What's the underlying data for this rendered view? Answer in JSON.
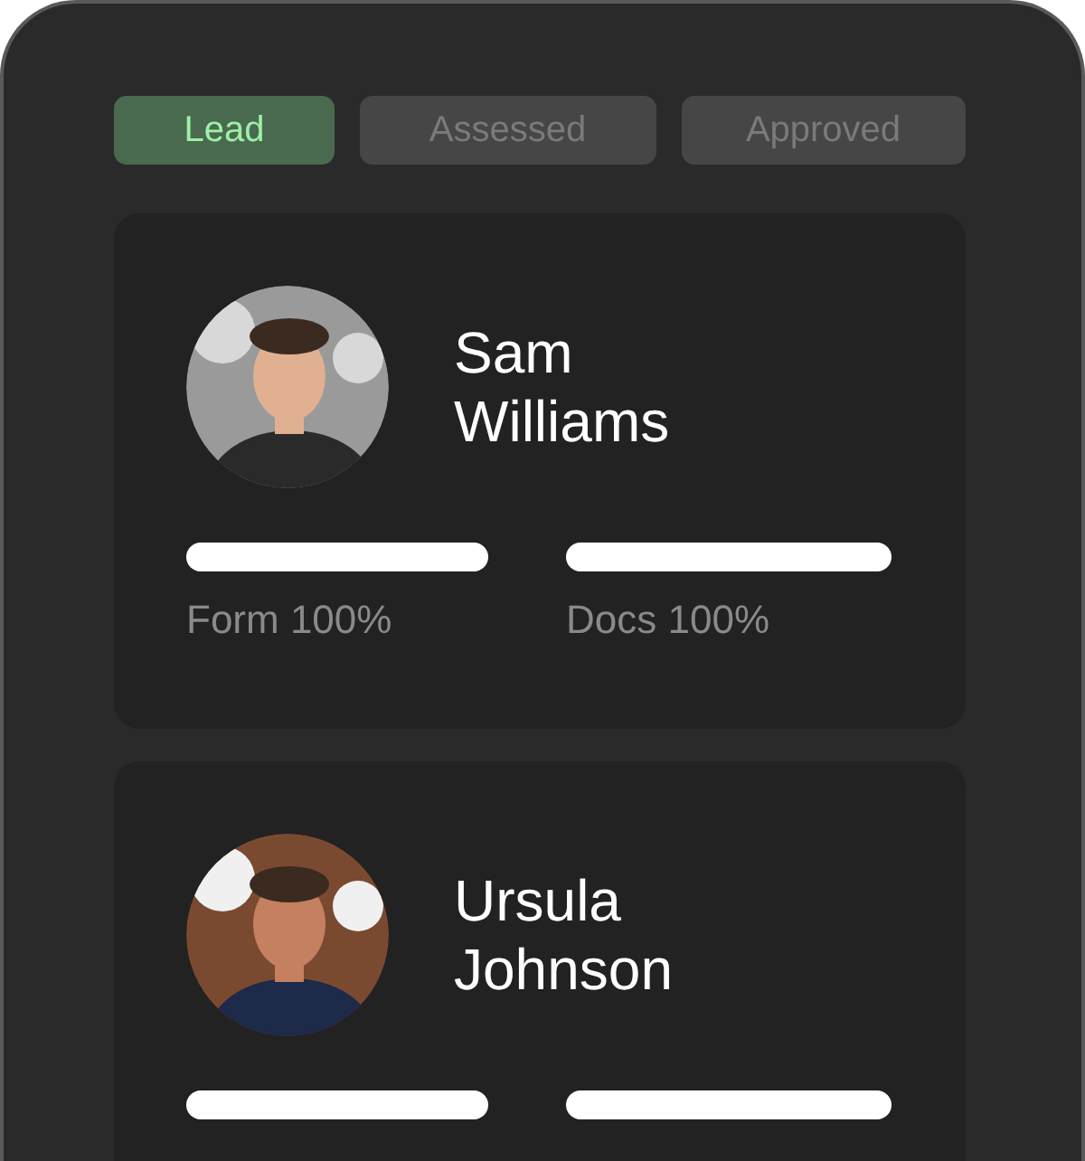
{
  "tabs": [
    {
      "label": "Lead",
      "selected": true
    },
    {
      "label": "Assessed",
      "selected": false
    },
    {
      "label": "Approved",
      "selected": false
    }
  ],
  "cards": [
    {
      "first_name": "Sam",
      "last_name": "Williams",
      "avatar": {
        "kind": "picture"
      },
      "metrics": [
        {
          "level": 1,
          "label": "Form 100%"
        },
        {
          "level": 1,
          "label": "Docs 100%"
        }
      ]
    },
    {
      "first_name": "Ursula",
      "last_name": "Johnson",
      "avatar": {
        "kind": "picture"
      },
      "metrics": [
        {
          "level": 1
        },
        {
          "level": 1
        }
      ]
    }
  ]
}
